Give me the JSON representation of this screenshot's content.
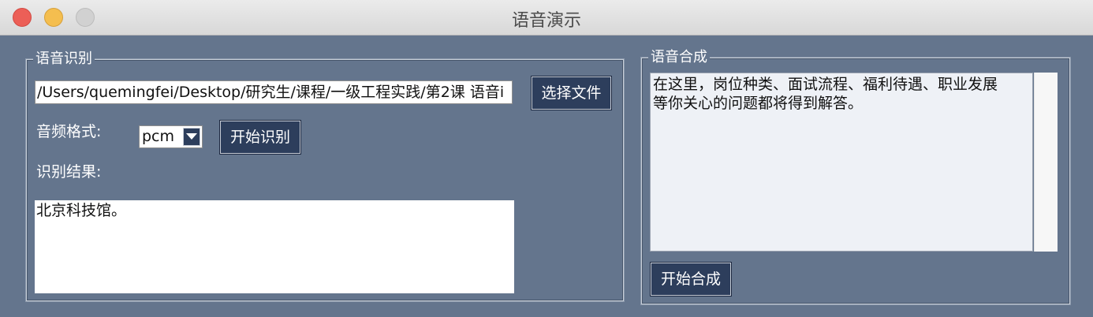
{
  "window": {
    "title": "语音演示"
  },
  "recognition": {
    "group_label": "语音识别",
    "file_path": "/Users/quemingfei/Desktop/研究生/课程/一级工程实践/第2课 语音i",
    "choose_file_label": "选择文件",
    "format_label": "音频格式:",
    "format_value": "pcm",
    "start_recognize_label": "开始识别",
    "result_label": "识别结果:",
    "result_text": "北京科技馆。"
  },
  "synthesis": {
    "group_label": "语音合成",
    "text": "在这里，岗位种类、面试流程、福利待遇、职业发展\n等你关心的问题都将得到解答。",
    "start_synthesize_label": "开始合成"
  },
  "colors": {
    "window_bg": "#64758d",
    "button_bg": "#2d3e5c",
    "close": "#ec5f57",
    "minimize": "#f4be4f",
    "zoom": "#d1d1d1"
  }
}
